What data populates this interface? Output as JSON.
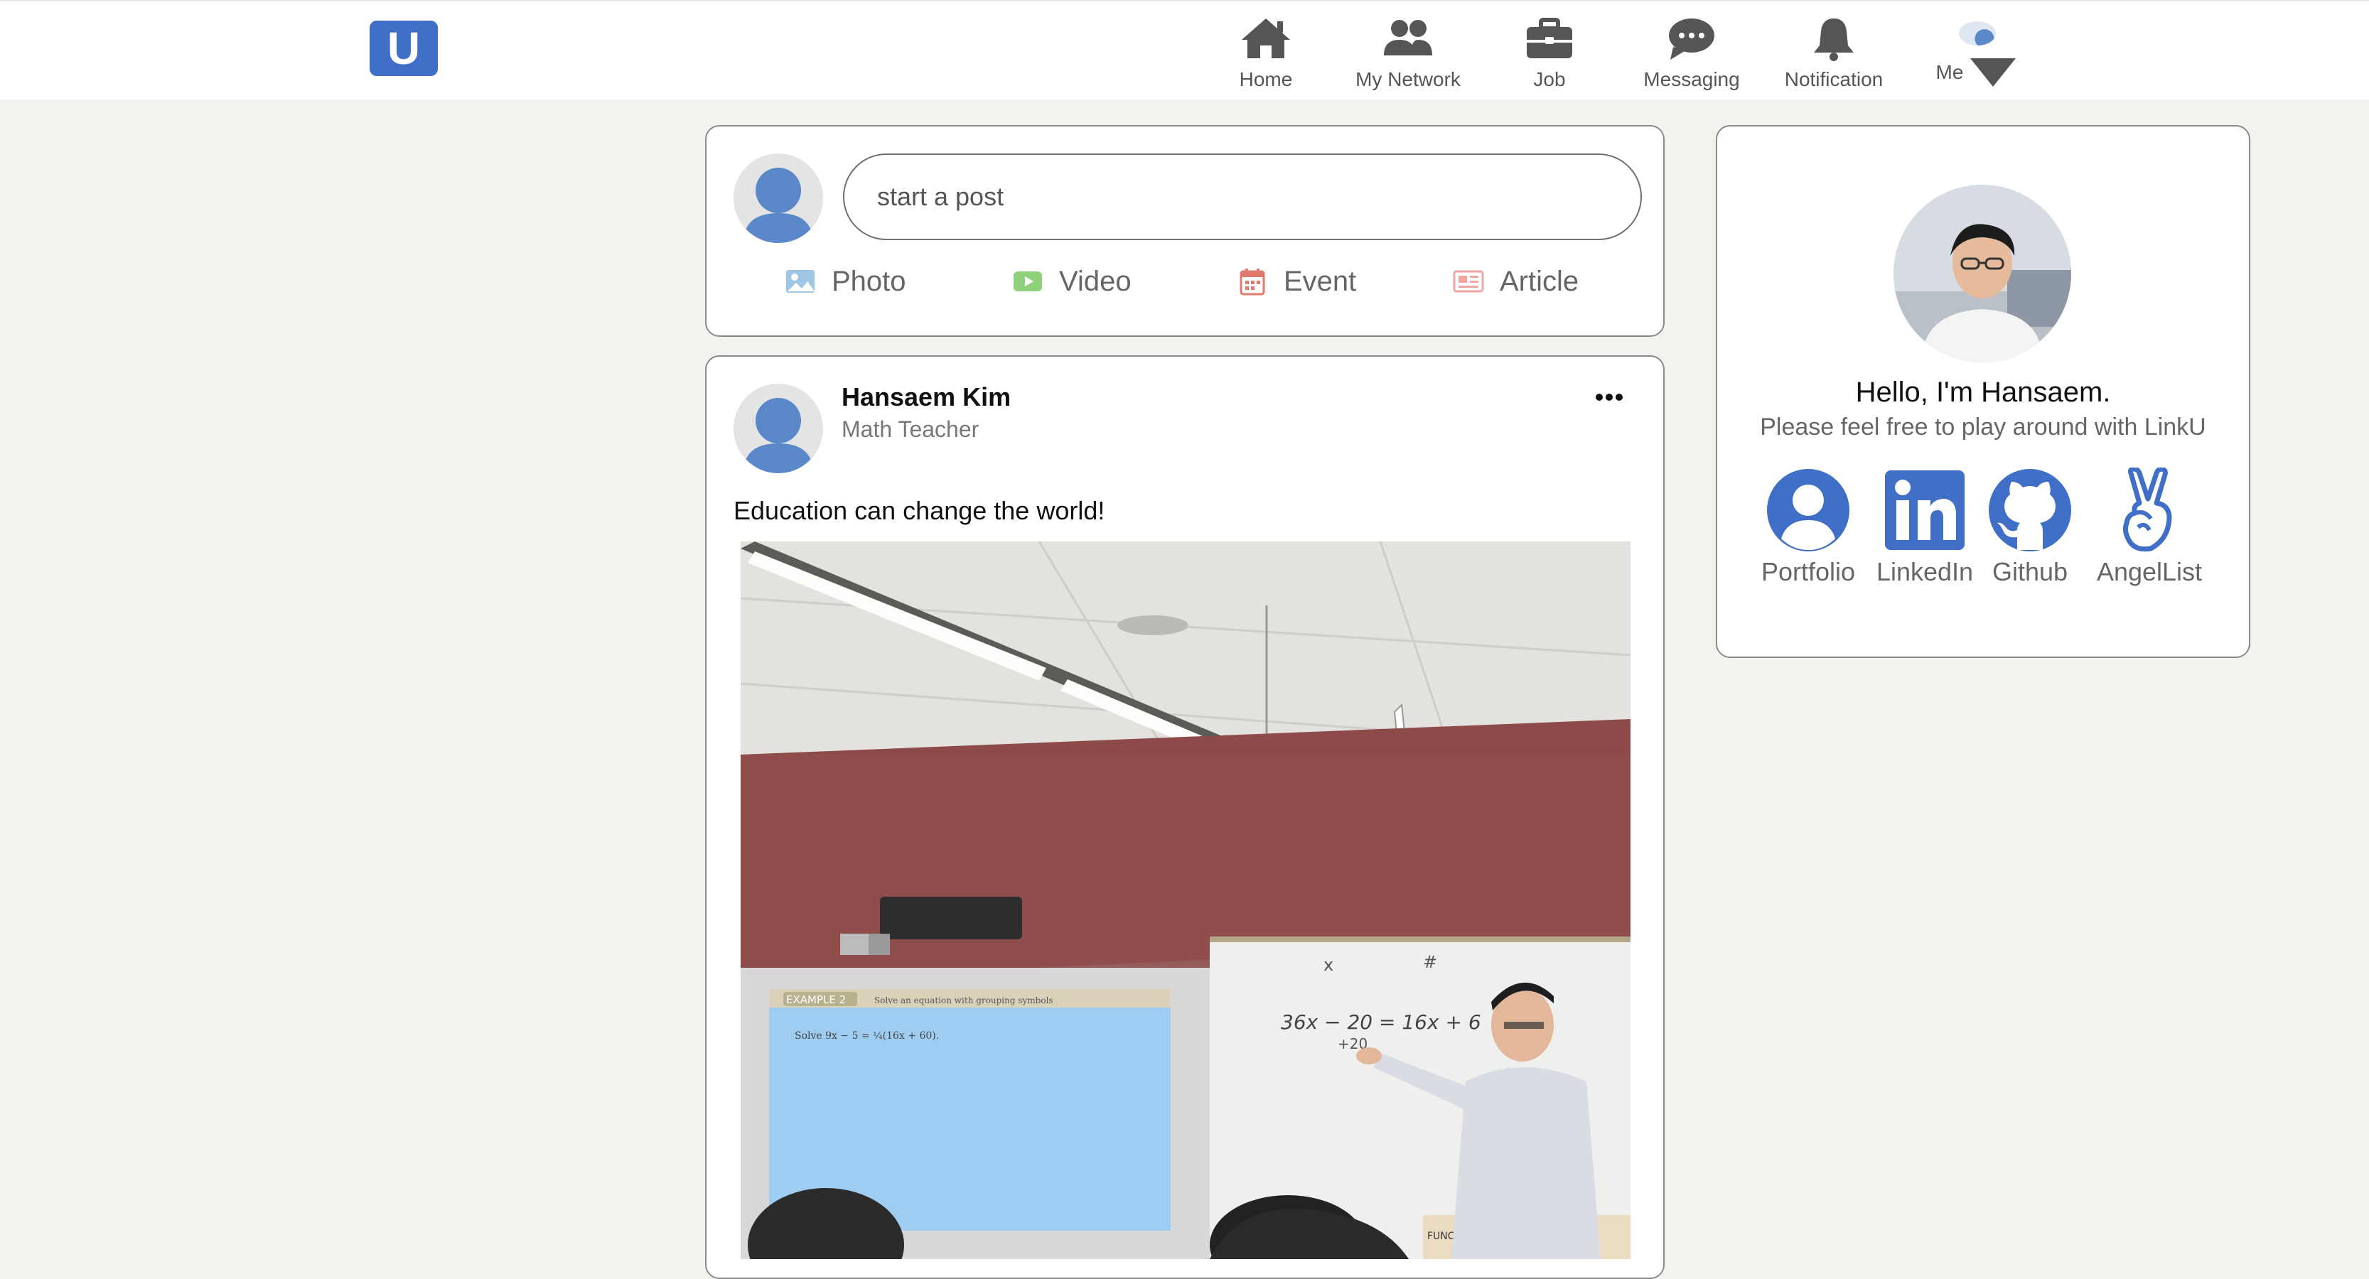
{
  "app": {
    "logo_letter": "U",
    "brand_color": "#3f6fc6"
  },
  "nav": {
    "items": [
      {
        "label": "Home",
        "icon": "home-icon"
      },
      {
        "label": "My Network",
        "icon": "people-icon"
      },
      {
        "label": "Job",
        "icon": "briefcase-icon"
      },
      {
        "label": "Messaging",
        "icon": "chat-icon"
      },
      {
        "label": "Notification",
        "icon": "bell-icon"
      }
    ],
    "me": {
      "label": "Me",
      "icon": "caret-down-icon"
    }
  },
  "composer": {
    "placeholder": "start a post",
    "actions": [
      {
        "label": "Photo",
        "icon": "photo-icon",
        "color": "#9fc6e4"
      },
      {
        "label": "Video",
        "icon": "video-icon",
        "color": "#8fd17b"
      },
      {
        "label": "Event",
        "icon": "calendar-icon",
        "color": "#e07a6e"
      },
      {
        "label": "Article",
        "icon": "article-icon",
        "color": "#f1a5a0"
      }
    ]
  },
  "post": {
    "author": "Hansaem Kim",
    "role": "Math Teacher",
    "text": "Education can change the world!",
    "image": {
      "slide_header": "EXAMPLE 2",
      "slide_title": "Solve an equation with grouping symbols",
      "slide_line": "Solve 9x − 5 = ¼(16x + 60).",
      "board_left": "36x − 20 = 16x + 6",
      "board_sub": "+20",
      "board_x": "x",
      "board_hash": "#",
      "board_bottom": "FUNCTIONS OF MULTIPLE ANGLES"
    }
  },
  "profile": {
    "greeting": "Hello, I'm Hansaem.",
    "subtitle": "Please feel free to play around with LinkU",
    "links": [
      {
        "label": "Portfolio",
        "icon": "user-circle-icon"
      },
      {
        "label": "LinkedIn",
        "icon": "linkedin-icon"
      },
      {
        "label": "Github",
        "icon": "github-icon"
      },
      {
        "label": "AngelList",
        "icon": "angellist-icon"
      }
    ],
    "accent_color": "#3f6fc6"
  }
}
